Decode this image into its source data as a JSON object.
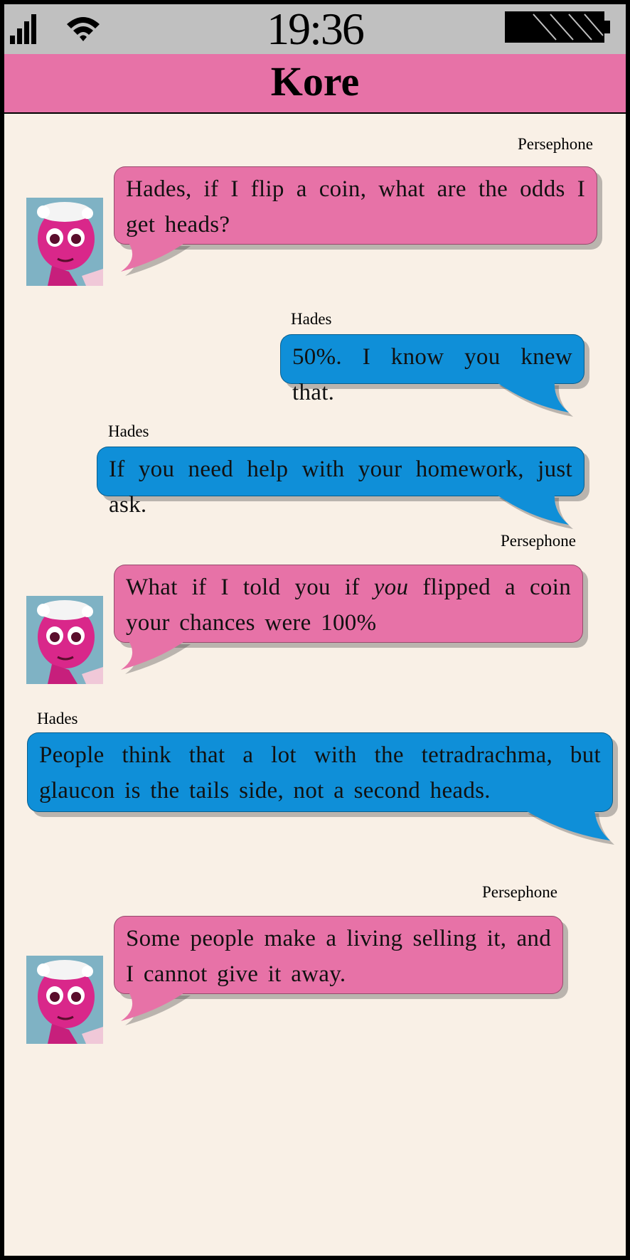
{
  "status_bar": {
    "time": "19:36",
    "signal_icon": "cellular-signal-icon",
    "wifi_icon": "wifi-icon",
    "battery_icon": "battery-icon"
  },
  "header": {
    "title": "Kore"
  },
  "colors": {
    "persephone_bubble": "#e772a7",
    "hades_bubble": "#0f8fd8",
    "background": "#f9f0e6",
    "status_bar": "#c0c0c0"
  },
  "messages": [
    {
      "sender": "Persephone",
      "text": "Hades, if I flip a coin, what are the odds I get heads?"
    },
    {
      "sender": "Hades",
      "text": "50%. I know you knew that."
    },
    {
      "sender": "Hades",
      "text": "If you need help with your homework, just ask."
    },
    {
      "sender": "Persephone",
      "text_before": "What if I told you if ",
      "text_em": "you",
      "text_after": " flipped a coin your chances were 100%"
    },
    {
      "sender": "Hades",
      "text": "People think that a lot with the tetradrachma, but glaucon is the tails side, not a second heads."
    },
    {
      "sender": "Persephone",
      "text": "Some people make a living selling it, and I cannot give it away."
    }
  ]
}
